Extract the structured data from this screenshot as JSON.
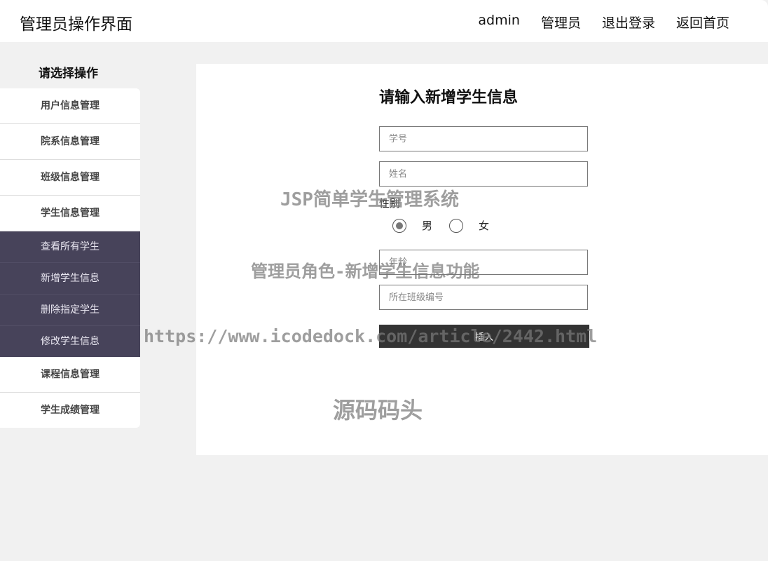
{
  "header": {
    "title": "管理员操作界面",
    "nav": [
      "admin",
      "管理员",
      "退出登录",
      "返回首页"
    ]
  },
  "sidebar": {
    "title": "请选择操作",
    "items": [
      {
        "label": "用户信息管理"
      },
      {
        "label": "院系信息管理"
      },
      {
        "label": "班级信息管理"
      },
      {
        "label": "学生信息管理"
      }
    ],
    "submenu": [
      {
        "label": "查看所有学生"
      },
      {
        "label": "新增学生信息"
      },
      {
        "label": "删除指定学生"
      },
      {
        "label": "修改学生信息"
      }
    ],
    "items_after": [
      {
        "label": "课程信息管理"
      },
      {
        "label": "学生成绩管理"
      }
    ]
  },
  "form": {
    "title": "请输入新增学生信息",
    "student_id_placeholder": "学号",
    "name_placeholder": "姓名",
    "gender_label": "性别",
    "gender_options": [
      "男",
      "女"
    ],
    "gender_selected": "男",
    "age_placeholder": "年龄",
    "class_id_placeholder": "所在班级编号",
    "submit_label": "插入"
  },
  "watermarks": [
    "JSP简单学生管理系统",
    "管理员角色-新增学生信息功能",
    "https://www.icodedock.com/article/2442.html",
    "源码码头"
  ],
  "colors": {
    "background": "#f1f1f1",
    "submenu_bg": "#47435a",
    "button_bg": "#333333"
  }
}
